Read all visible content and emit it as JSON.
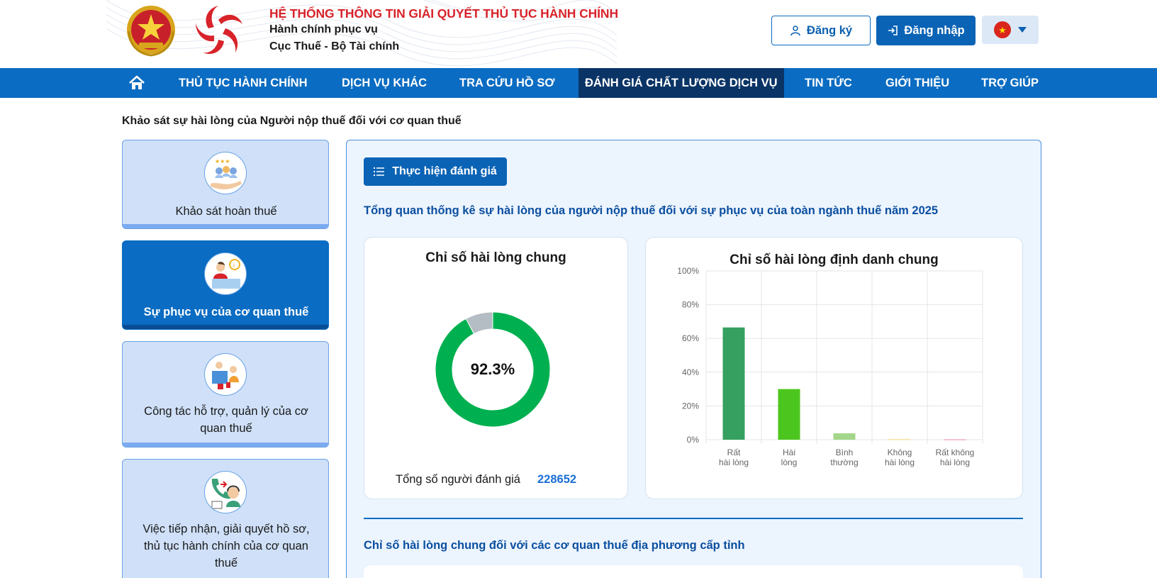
{
  "header": {
    "title": "HỆ THỐNG THÔNG TIN GIẢI QUYẾT THỦ TỤC HÀNH CHÍNH",
    "subtitle1": "Hành chính phục vụ",
    "subtitle2": "Cục Thuế - Bộ Tài chính",
    "register_label": "Đăng ký",
    "login_label": "Đăng nhập",
    "language_flag": "vietnam-flag-icon"
  },
  "nav": {
    "items": [
      {
        "label": "THỦ TỤC HÀNH CHÍNH"
      },
      {
        "label": "DỊCH VỤ KHÁC"
      },
      {
        "label": "TRA CỨU HỒ SƠ"
      },
      {
        "label": "ĐÁNH GIÁ CHẤT LƯỢNG DỊCH VỤ",
        "active": true
      },
      {
        "label": "TIN TỨC"
      },
      {
        "label": "GIỚI THIỆU"
      },
      {
        "label": "TRỢ GIÚP"
      }
    ]
  },
  "page": {
    "heading": "Khảo sát sự hài lòng của Người nộp thuế đối với cơ quan thuế"
  },
  "sidebar": {
    "items": [
      {
        "label": "Khảo sát hoàn thuế",
        "icon": "refund-survey-icon"
      },
      {
        "label": "Sự phục vụ của cơ quan thuế",
        "icon": "tax-service-icon",
        "active": true
      },
      {
        "label": "Công tác hỗ trợ, quản lý của cơ quan thuế",
        "icon": "support-management-icon"
      },
      {
        "label": "Việc tiếp nhận, giải quyết hồ sơ, thủ tục hành chính của cơ quan thuế",
        "icon": "call-center-icon"
      }
    ]
  },
  "main": {
    "evaluate_label": "Thực hiện đánh giá",
    "overview_title": "Tổng quan thống kê sự hài lòng của người nộp thuế đối với sự phục vụ của toàn ngành thuế năm 2025",
    "donut": {
      "title": "Chỉ số hài lòng chung",
      "center_label": "92.3%",
      "total_label": "Tổng số người đánh giá",
      "total_value": "228652"
    },
    "bar": {
      "title": "Chỉ số hài lòng định danh chung"
    },
    "provincial_title": "Chỉ số hài lòng chung đối với các cơ quan thuế địa phương cấp tỉnh"
  },
  "colors": {
    "primary": "#0a6cc2",
    "nav_active": "#0b3466",
    "title_red": "#d8232a",
    "donut_green": "#00b050",
    "donut_grey": "#b4bcc4"
  },
  "chart_data": [
    {
      "type": "pie",
      "title": "Chỉ số hài lòng chung",
      "labels": [
        "",
        ""
      ],
      "values": [
        92.3,
        7.7
      ],
      "colors": [
        "#00b050",
        "#b4bcc4"
      ]
    },
    {
      "type": "bar",
      "title": "Chỉ số hài lòng định danh chung",
      "categories": [
        [
          "Rất",
          "hài lòng"
        ],
        [
          "Hài",
          "lòng"
        ],
        [
          "Bình",
          "thường"
        ],
        [
          "Không",
          "hài lòng"
        ],
        [
          "Rất không",
          "hài lòng"
        ]
      ],
      "values": [
        66.5,
        30.0,
        3.8,
        0.3,
        0.2
      ],
      "colors": [
        "#36a060",
        "#4cc61e",
        "#a3d68a",
        "#f3d779",
        "#e8879c"
      ],
      "ylim": [
        0,
        100
      ],
      "yticks": [
        "0%",
        "20%",
        "40%",
        "60%",
        "80%",
        "100%"
      ],
      "grid": true
    }
  ]
}
